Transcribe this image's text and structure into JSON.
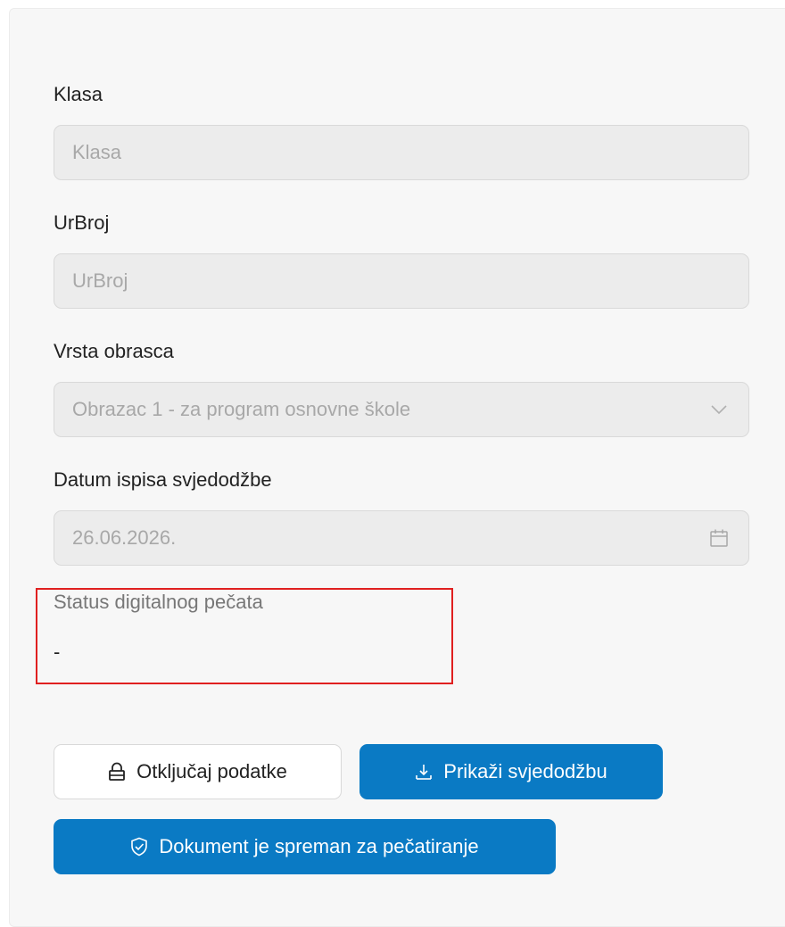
{
  "form": {
    "klasa": {
      "label": "Klasa",
      "placeholder": "Klasa"
    },
    "urbroj": {
      "label": "UrBroj",
      "placeholder": "UrBroj"
    },
    "vrsta_obrasca": {
      "label": "Vrsta obrasca",
      "selected": "Obrazac 1 - za program osnovne škole",
      "icon": "chevron-down-icon"
    },
    "datum_ispisa": {
      "label": "Datum ispisa svjedodžbe",
      "value": "26.06.2026.",
      "icon": "calendar-icon"
    },
    "status_pecata": {
      "label": "Status digitalnog pečata",
      "value": "-"
    }
  },
  "actions": {
    "unlock": {
      "label": "Otključaj podatke",
      "icon": "lock-icon"
    },
    "show_certificate": {
      "label": "Prikaži svjedodžbu",
      "icon": "download-icon"
    },
    "ready_for_seal": {
      "label": "Dokument je spreman za pečatiranje",
      "icon": "shield-check-icon"
    }
  },
  "colors": {
    "primary": "#0a7ac4",
    "highlight": "#e02020",
    "disabled_bg": "#ececec",
    "disabled_text": "#a8a8a8"
  }
}
